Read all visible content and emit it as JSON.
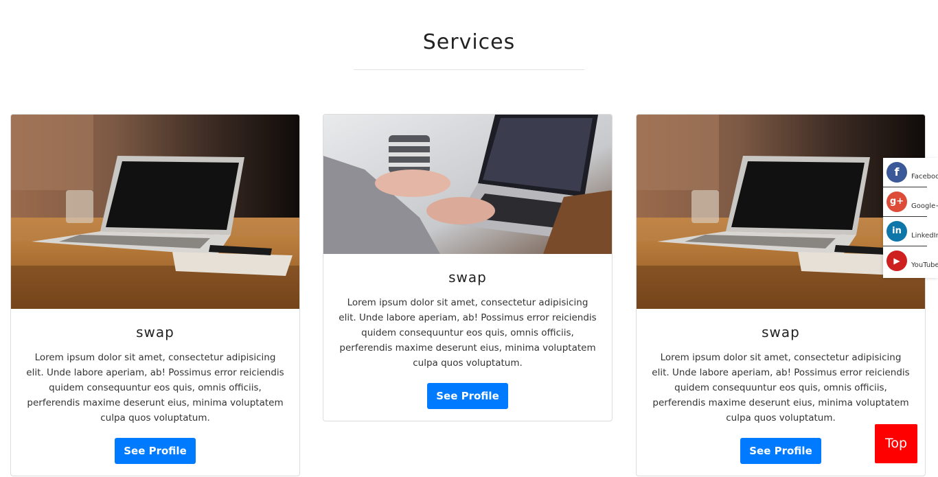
{
  "section": {
    "title": "Services"
  },
  "cards": [
    {
      "title": "swap",
      "text": "Lorem ipsum dolor sit amet, consectetur adipisicing elit. Unde labore aperiam, ab! Possimus error reiciendis quidem consequuntur eos quis, omnis officiis, perferendis maxime deserunt eius, minima voluptatem culpa quos voluptatum.",
      "button": "See Profile"
    },
    {
      "title": "swap",
      "text": "Lorem ipsum dolor sit amet, consectetur adipisicing elit. Unde labore aperiam, ab! Possimus error reiciendis quidem consequuntur eos quis, omnis officiis, perferendis maxime deserunt eius, minima voluptatem culpa quos voluptatum.",
      "button": "See Profile"
    },
    {
      "title": "swap",
      "text": "Lorem ipsum dolor sit amet, consectetur adipisicing elit. Unde labore aperiam, ab! Possimus error reiciendis quidem consequuntur eos quis, omnis officiis, perferendis maxime deserunt eius, minima voluptatem culpa quos voluptatum.",
      "button": "See Profile"
    }
  ],
  "social": [
    {
      "label": "Faceboo",
      "icon": "facebook-icon",
      "glyph": "f",
      "color": "#3b5998"
    },
    {
      "label": "Google+",
      "icon": "google-plus-icon",
      "glyph": "g+",
      "color": "#dd4b39"
    },
    {
      "label": "LinkedIn",
      "icon": "linkedin-icon",
      "glyph": "in",
      "color": "#0e76a8"
    },
    {
      "label": "YouTube",
      "icon": "youtube-icon",
      "glyph": "▶",
      "color": "#cd201f"
    }
  ],
  "top_button": {
    "label": "Top",
    "color": "#ff0000"
  },
  "colors": {
    "primary": "#007bff"
  }
}
